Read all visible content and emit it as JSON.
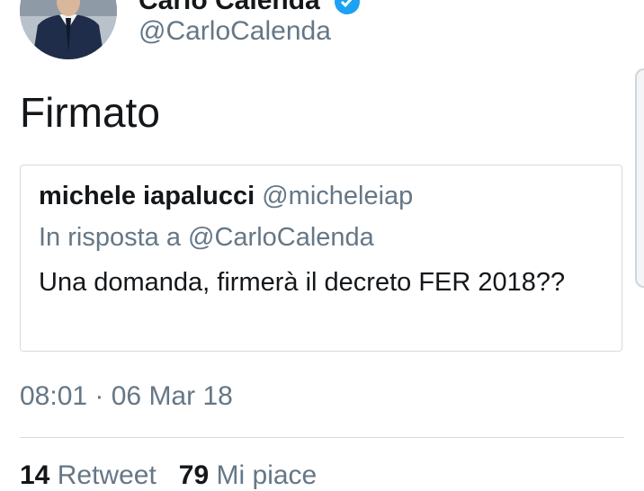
{
  "author": {
    "name": "Carlo Calenda",
    "handle": "@CarloCalenda",
    "verified": true
  },
  "tweet": {
    "text": "Firmato",
    "timestamp": "08:01 · 06 Mar 18"
  },
  "quoted_tweet": {
    "author_name": "michele iapalucci",
    "author_handle": "@micheleiap",
    "reply_to": "In risposta a @CarloCalenda",
    "text": "Una domanda, firmerà il decreto FER 2018??"
  },
  "stats": {
    "retweets_count": "14",
    "retweets_label": "Retweet",
    "likes_count": "79",
    "likes_label": "Mi piace"
  },
  "colors": {
    "text_primary": "#14171a",
    "text_secondary": "#657786",
    "verified_blue": "#1da1f2",
    "border": "#d4dbe1"
  },
  "icons": [
    "avatar-photo",
    "verified-badge-icon"
  ]
}
